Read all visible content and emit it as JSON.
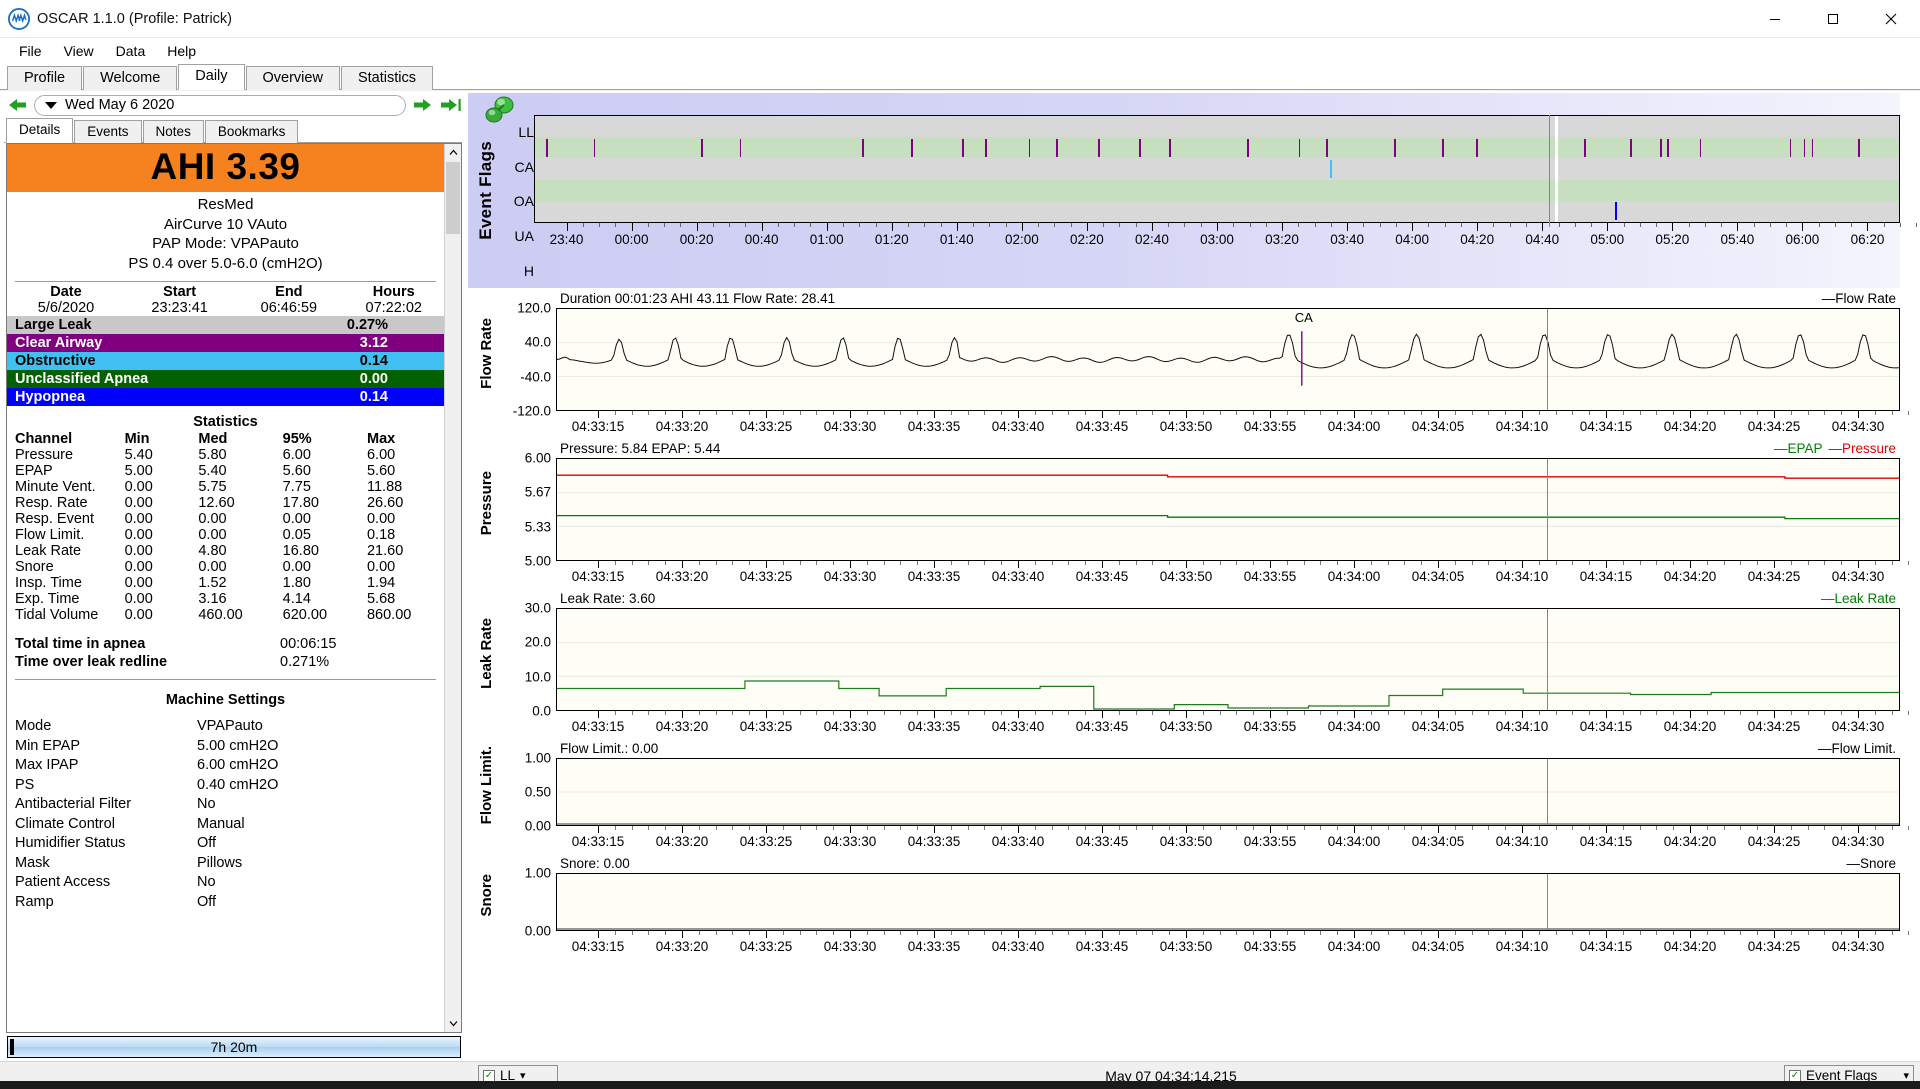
{
  "window": {
    "title": "OSCAR 1.1.0 (Profile: Patrick)",
    "app_icon": "oscar-logo-icon",
    "minimize": "–",
    "maximize": "▢",
    "close": "✕"
  },
  "menubar": {
    "items": [
      "File",
      "View",
      "Data",
      "Help"
    ]
  },
  "main_tabs": {
    "items": [
      "Profile",
      "Welcome",
      "Daily",
      "Overview",
      "Statistics"
    ],
    "active": "Daily"
  },
  "date_navigator": {
    "back_icon": "arrow-left-icon",
    "forward_icon": "arrow-right-icon",
    "end_icon": "arrow-to-end-icon",
    "value": "Wed May 6 2020",
    "dropdown_icon": "caret-down-icon"
  },
  "sub_tabs": {
    "items": [
      "Details",
      "Events",
      "Notes",
      "Bookmarks"
    ],
    "active": "Details"
  },
  "details": {
    "ahi_label": "AHI 3.39",
    "ahi_banner_color": "#f5821f",
    "manufacturer": "ResMed",
    "model": "AirCurve 10 VAuto",
    "pap_mode": "PAP Mode: VPAPauto",
    "pressure_summary": "PS 0.4 over 5.0-6.0 (cmH2O)",
    "session_headers": [
      "Date",
      "Start",
      "End",
      "Hours"
    ],
    "session_values": [
      "5/6/2020",
      "23:23:41",
      "06:46:59",
      "07:22:02"
    ],
    "event_rows": [
      {
        "label": "Large Leak",
        "value": "0.27%",
        "bg": "#c8c8c8",
        "fg": "#000000"
      },
      {
        "label": "Clear Airway",
        "value": "3.12",
        "bg": "#800080",
        "fg": "#ffffff"
      },
      {
        "label": "Obstructive",
        "value": "0.14",
        "bg": "#40c0f0",
        "fg": "#000000"
      },
      {
        "label": "Unclassified Apnea",
        "value": "0.00",
        "bg": "#056000",
        "fg": "#ffffff"
      },
      {
        "label": "Hypopnea",
        "value": "0.14",
        "bg": "#0000ff",
        "fg": "#ffffff"
      }
    ],
    "statistics_title": "Statistics",
    "statistics_headers": [
      "Channel",
      "Min",
      "Med",
      "95%",
      "Max"
    ],
    "statistics_rows": [
      [
        "Pressure",
        "5.40",
        "5.80",
        "6.00",
        "6.00"
      ],
      [
        "EPAP",
        "5.00",
        "5.40",
        "5.60",
        "5.60"
      ],
      [
        "Minute Vent.",
        "0.00",
        "5.75",
        "7.75",
        "11.88"
      ],
      [
        "Resp. Rate",
        "0.00",
        "12.60",
        "17.80",
        "26.60"
      ],
      [
        "Resp. Event",
        "0.00",
        "0.00",
        "0.00",
        "0.00"
      ],
      [
        "Flow Limit.",
        "0.00",
        "0.00",
        "0.05",
        "0.18"
      ],
      [
        "Leak Rate",
        "0.00",
        "4.80",
        "16.80",
        "21.60"
      ],
      [
        "Snore",
        "0.00",
        "0.00",
        "0.00",
        "0.00"
      ],
      [
        "Insp. Time",
        "0.00",
        "1.52",
        "1.80",
        "1.94"
      ],
      [
        "Exp. Time",
        "0.00",
        "3.16",
        "4.14",
        "5.68"
      ],
      [
        "Tidal Volume",
        "0.00",
        "460.00",
        "620.00",
        "860.00"
      ]
    ],
    "totals": [
      {
        "label": "Total time in apnea",
        "value": "00:06:15"
      },
      {
        "label": "Time over leak redline",
        "value": "0.271%"
      }
    ],
    "machine_settings_title": "Machine Settings",
    "machine_settings": [
      {
        "key": "Mode",
        "value": "VPAPauto"
      },
      {
        "key": "Min EPAP",
        "value": "5.00 cmH2O"
      },
      {
        "key": "Max IPAP",
        "value": "6.00 cmH2O"
      },
      {
        "key": "PS",
        "value": "0.40 cmH2O"
      },
      {
        "key": "Antibacterial Filter",
        "value": "No"
      },
      {
        "key": "Climate Control",
        "value": "Manual"
      },
      {
        "key": "Humidifier Status",
        "value": "Off"
      },
      {
        "key": "Mask",
        "value": "Pillows"
      },
      {
        "key": "Patient Access",
        "value": "No"
      },
      {
        "key": "Ramp",
        "value": "Off"
      }
    ],
    "hours_bar_label": "7h 20m"
  },
  "status_bar": {
    "left_combo_label": "LL",
    "center_text": "May 07 04:34:14.215",
    "right_combo_label": "Event Flags",
    "checkbox_icon": "checkbox-checked-icon",
    "dropdown_icon": "caret-down-small-icon"
  },
  "chart_data": [
    {
      "type": "heatmap",
      "name": "event-flags",
      "title": "Event Flags",
      "categories": [
        "LL",
        "CA",
        "OA",
        "UA",
        "H"
      ],
      "xlabel": "",
      "ylabel": "Event Flags",
      "x_ticks": [
        "23:40",
        "00:00",
        "00:20",
        "00:40",
        "01:00",
        "01:20",
        "01:40",
        "02:00",
        "02:20",
        "02:40",
        "03:00",
        "03:20",
        "03:40",
        "04:00",
        "04:20",
        "04:40",
        "05:00",
        "05:20",
        "05:40",
        "06:00",
        "06:20"
      ],
      "band_colors": [
        "#d8d8d8",
        "#c6dfc0",
        "#d8d8d8",
        "#c6dfc0",
        "#d8d8d8"
      ],
      "series": [
        {
          "name": "CA",
          "color": "#800080",
          "row": 1,
          "marks": [
            0.8,
            4.3,
            12.2,
            15.0,
            24.0,
            27.6,
            31.3,
            33.0,
            36.2,
            38.2,
            41.3,
            44.3,
            46.5,
            52.2,
            56.0,
            58.0,
            63.0,
            66.5,
            69.0,
            76.9,
            80.3,
            82.5,
            83.0,
            85.4,
            92.0,
            93.0,
            93.6,
            97.0
          ]
        },
        {
          "name": "OA",
          "color": "#40c0f0",
          "row": 2,
          "marks": [
            58.3
          ]
        },
        {
          "name": "H",
          "color": "#0000ff",
          "row": 4,
          "marks": [
            79.2
          ]
        },
        {
          "name": "cursor-white",
          "color": "#ffffff",
          "row": -1,
          "marks": [
            74.8
          ]
        }
      ]
    },
    {
      "type": "line",
      "name": "flow-rate",
      "header": "Duration 00:01:23 AHI 43.11 Flow Rate: 28.41",
      "legend": "Flow Rate",
      "legend_color": "#000000",
      "ylabel": "Flow Rate",
      "y_ticks": [
        "120.0",
        "40.0",
        "-40.0",
        "-120.0"
      ],
      "ylim": [
        -120,
        120
      ],
      "annotation": "CA",
      "annotation_color": "#800080",
      "x_ticks": [
        "04:33:15",
        "04:33:20",
        "04:33:25",
        "04:33:30",
        "04:33:35",
        "04:33:40",
        "04:33:45",
        "04:33:50",
        "04:33:55",
        "04:34:00",
        "04:34:05",
        "04:34:10",
        "04:34:15",
        "04:34:20",
        "04:34:25",
        "04:34:30"
      ],
      "cursor_pct": 73.8
    },
    {
      "type": "line",
      "name": "pressure",
      "header": "Pressure: 5.84 EPAP: 5.44",
      "legend": [
        "EPAP",
        "Pressure"
      ],
      "legend_colors": [
        "#008000",
        "#e00000"
      ],
      "ylabel": "Pressure",
      "y_ticks": [
        "6.00",
        "5.67",
        "5.33",
        "5.00"
      ],
      "ylim": [
        5.0,
        6.0
      ],
      "series": [
        {
          "name": "Pressure",
          "color": "#e00000",
          "value": 5.84
        },
        {
          "name": "EPAP",
          "color": "#008000",
          "value": 5.44
        }
      ],
      "x_ticks": [
        "04:33:15",
        "04:33:20",
        "04:33:25",
        "04:33:30",
        "04:33:35",
        "04:33:40",
        "04:33:45",
        "04:33:50",
        "04:33:55",
        "04:34:00",
        "04:34:05",
        "04:34:10",
        "04:34:15",
        "04:34:20",
        "04:34:25",
        "04:34:30"
      ],
      "cursor_pct": 73.8
    },
    {
      "type": "line",
      "name": "leak-rate",
      "header": "Leak Rate: 3.60",
      "legend": "Leak Rate",
      "legend_color": "#008000",
      "ylabel": "Leak Rate",
      "y_ticks": [
        "30.0",
        "20.0",
        "10.0",
        "0.0"
      ],
      "ylim": [
        0,
        30
      ],
      "x_ticks": [
        "04:33:15",
        "04:33:20",
        "04:33:25",
        "04:33:30",
        "04:33:35",
        "04:33:40",
        "04:33:45",
        "04:33:50",
        "04:33:55",
        "04:34:00",
        "04:34:05",
        "04:34:10",
        "04:34:15",
        "04:34:20",
        "04:34:25",
        "04:34:30"
      ],
      "cursor_pct": 73.8
    },
    {
      "type": "line",
      "name": "flow-limit",
      "header": "Flow Limit.: 0.00",
      "legend": "Flow Limit.",
      "legend_color": "#000000",
      "ylabel": "Flow Limit.",
      "y_ticks": [
        "1.00",
        "0.50",
        "0.00"
      ],
      "ylim": [
        0,
        1
      ],
      "x_ticks": [
        "04:33:15",
        "04:33:20",
        "04:33:25",
        "04:33:30",
        "04:33:35",
        "04:33:40",
        "04:33:45",
        "04:33:50",
        "04:33:55",
        "04:34:00",
        "04:34:05",
        "04:34:10",
        "04:34:15",
        "04:34:20",
        "04:34:25",
        "04:34:30"
      ],
      "cursor_pct": 73.8
    },
    {
      "type": "line",
      "name": "snore",
      "header": "Snore: 0.00",
      "legend": "Snore",
      "legend_color": "#000000",
      "ylabel": "Snore",
      "y_ticks": [
        "1.00",
        "0.00"
      ],
      "ylim": [
        0,
        1
      ],
      "x_ticks": [
        "04:33:15",
        "04:33:20",
        "04:33:25",
        "04:33:30",
        "04:33:35",
        "04:33:40",
        "04:33:45",
        "04:33:50",
        "04:33:55",
        "04:34:00",
        "04:34:05",
        "04:34:10",
        "04:34:15",
        "04:34:20",
        "04:34:25",
        "04:34:30"
      ],
      "cursor_pct": 73.8
    }
  ]
}
